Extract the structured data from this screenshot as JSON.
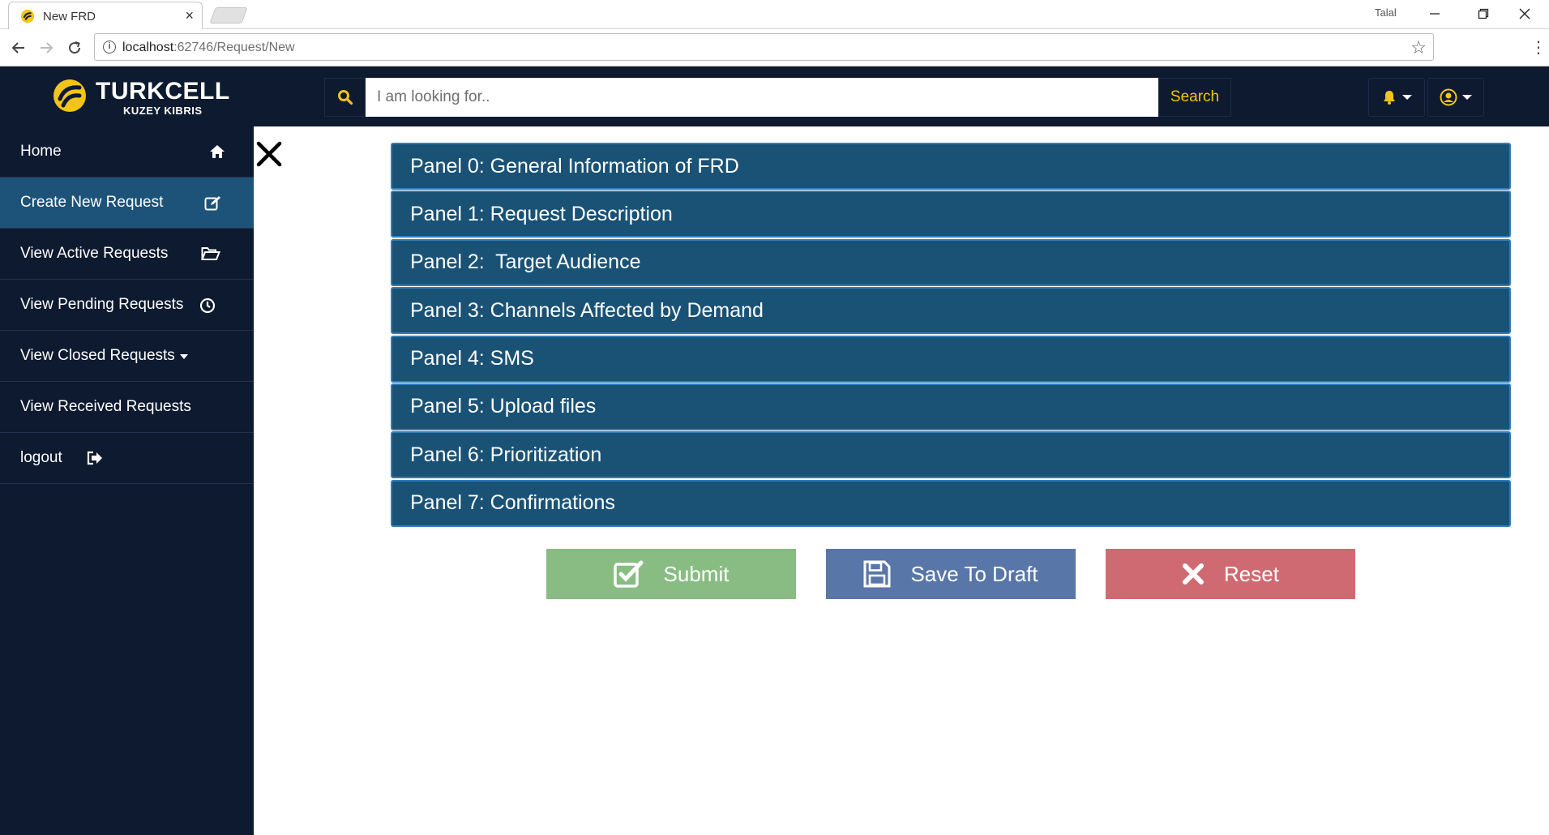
{
  "browser": {
    "tab_title": "New FRD",
    "tab_close": "×",
    "profile_name": "Talal",
    "url_host": "localhost",
    "url_path": ":62746/Request/New"
  },
  "header": {
    "logo_text": "TURKCELL",
    "logo_sub": "KUZEY KIBRIS",
    "search_placeholder": "I am looking for..",
    "search_button": "Search",
    "accent_color": "#f4c417"
  },
  "sidebar": {
    "items": [
      {
        "label": "Home",
        "icon": "home-icon"
      },
      {
        "label": "Create New Request",
        "icon": "edit-icon",
        "active": true
      },
      {
        "label": "View Active Requests",
        "icon": "folder-open-icon"
      },
      {
        "label": "View Pending Requests",
        "icon": "clock-icon"
      },
      {
        "label": "View Closed Requests",
        "icon": "caret-down-icon"
      },
      {
        "label": "View Received Requests"
      },
      {
        "label": "logout",
        "icon": "sign-out-icon"
      }
    ]
  },
  "panels": [
    "Panel 0: General Information of FRD",
    "Panel 1: Request Description",
    "Panel 2:  Target Audience",
    "Panel 3: Channels Affected by Demand",
    "Panel 4: SMS",
    "Panel 5: Upload files",
    "Panel 6: Prioritization",
    "Panel 7: Confirmations"
  ],
  "actions": {
    "submit": "Submit",
    "save_draft": "Save To Draft",
    "reset": "Reset"
  }
}
